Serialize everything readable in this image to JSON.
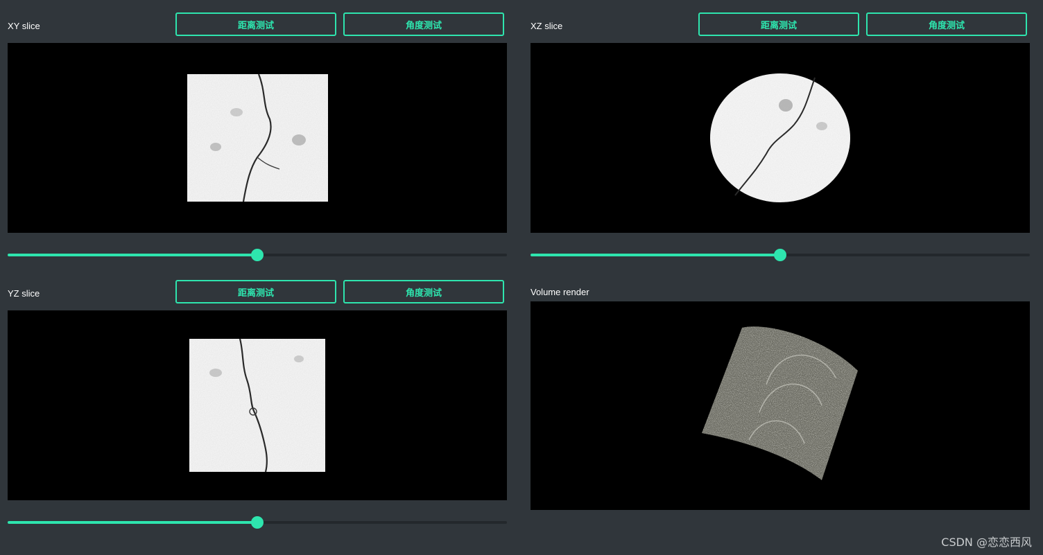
{
  "panels": {
    "xy": {
      "title": "XY slice",
      "distance_btn": "距离测试",
      "angle_btn": "角度测试",
      "slider_value": 0.5
    },
    "xz": {
      "title": "XZ slice",
      "distance_btn": "距离测试",
      "angle_btn": "角度测试",
      "slider_value": 0.5
    },
    "yz": {
      "title": "YZ slice",
      "distance_btn": "距离测试",
      "angle_btn": "角度测试",
      "slider_value": 0.5
    },
    "volume": {
      "title": "Volume render"
    }
  },
  "watermark": "CSDN @恋恋西风",
  "colors": {
    "accent": "#2ee5ae",
    "background": "#30363b",
    "viewport": "#000000"
  }
}
